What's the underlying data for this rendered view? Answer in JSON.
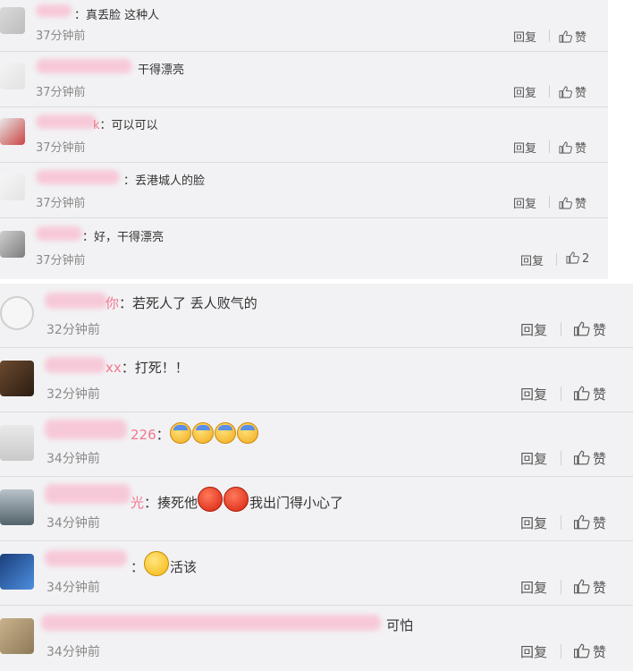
{
  "panel_a": {
    "comments": [
      {
        "user_suffix": "",
        "text": "：真丢脸 这种人",
        "time": "37分钟前",
        "reply": "回复",
        "like": "赞"
      },
      {
        "user_suffix": "",
        "text": "干得漂亮",
        "time": "37分钟前",
        "reply": "回复",
        "like": "赞"
      },
      {
        "user_suffix": "k",
        "text": "：可以可以",
        "time": "37分钟前",
        "reply": "回复",
        "like": "赞"
      },
      {
        "user_suffix": "",
        "text": "：丢港城人的脸",
        "time": "37分钟前",
        "reply": "回复",
        "like": "赞"
      },
      {
        "user_suffix": "",
        "text": "：好，干得漂亮",
        "time": "37分钟前",
        "reply": "回复",
        "like": "2"
      }
    ]
  },
  "panel_b": {
    "comments": [
      {
        "user_suffix": "你",
        "text": "：若死人了 丢人败气的",
        "time": "32分钟前",
        "reply": "回复",
        "like": "赞"
      },
      {
        "user_suffix": "xx",
        "text": "：打死！！",
        "time": "32分钟前",
        "reply": "回复",
        "like": "赞"
      },
      {
        "user_suffix": "226",
        "text": "：",
        "time": "34分钟前",
        "reply": "回复",
        "like": "赞",
        "emoji": [
          "sweat-emoji",
          "sweat-emoji",
          "sweat-emoji",
          "sweat-emoji"
        ]
      },
      {
        "user_suffix": "光",
        "text": "：揍死他",
        "text_after": "我出门得小心了",
        "time": "34分钟前",
        "reply": "回复",
        "like": "赞",
        "emoji": [
          "angry-emoji",
          "angry-emoji"
        ]
      },
      {
        "user_suffix": "",
        "text": "：",
        "text_after": "活该",
        "time": "34分钟前",
        "reply": "回复",
        "like": "赞",
        "emoji": [
          "grin-emoji"
        ]
      },
      {
        "user_suffix": "",
        "text": "可怕",
        "time": "34分钟前",
        "reply": "回复",
        "like": "赞"
      }
    ]
  },
  "colors": {
    "username": "#f0788f",
    "panel_bg": "#f2f2f4",
    "text": "#333333",
    "meta": "#8a8a8a"
  }
}
